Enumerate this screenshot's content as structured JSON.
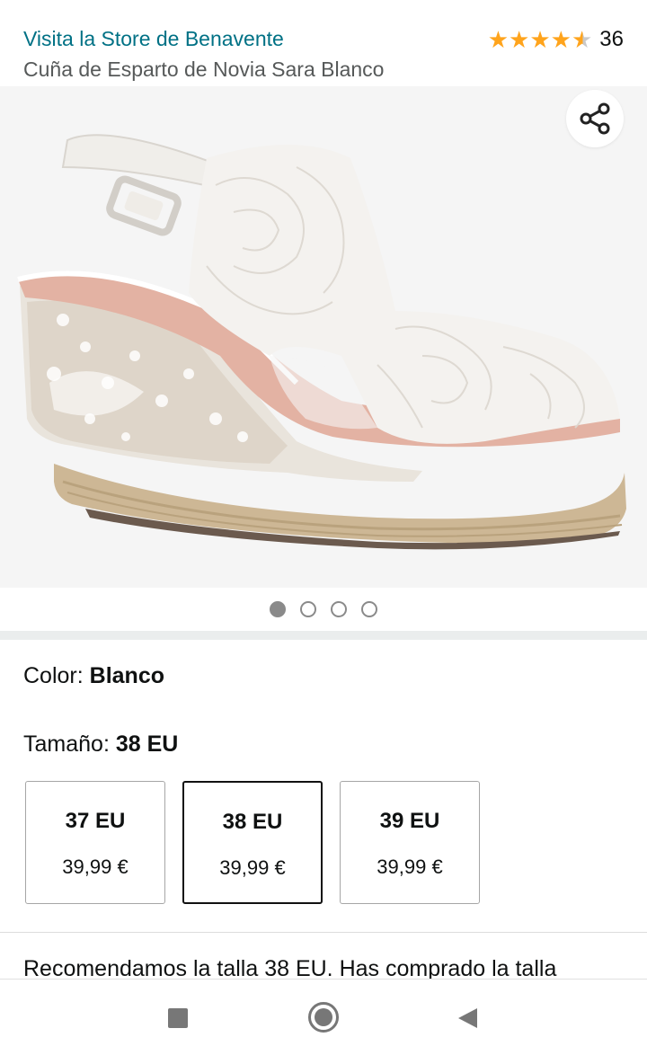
{
  "header": {
    "store_link": "Visita la Store de Benavente",
    "product_title": "Cuña de Esparto de Novia Sara Blanco",
    "rating_stars": 4.5,
    "rating_count": "36"
  },
  "gallery": {
    "share_icon": "share-icon",
    "image_subject": "white lace wedge espadrille sandal",
    "dot_count": 4,
    "active_dot": 1
  },
  "color": {
    "label": "Color: ",
    "value": "Blanco"
  },
  "size": {
    "label": "Tamaño: ",
    "value": "38 EU",
    "options": [
      {
        "label": "37 EU",
        "price": "39,99 €",
        "selected": false
      },
      {
        "label": "38 EU",
        "price": "39,99 €",
        "selected": true
      },
      {
        "label": "39 EU",
        "price": "39,99 €",
        "selected": false
      }
    ]
  },
  "recommendation": "Recomendamos la talla 38 EU. Has comprado la talla",
  "navbar": {
    "recents_icon": "square-icon",
    "home_icon": "home-circle-icon",
    "back_icon": "back-triangle-icon"
  },
  "colors": {
    "link": "#007185",
    "star": "#ffa41c",
    "gallery_bg": "#f5f5f5"
  }
}
